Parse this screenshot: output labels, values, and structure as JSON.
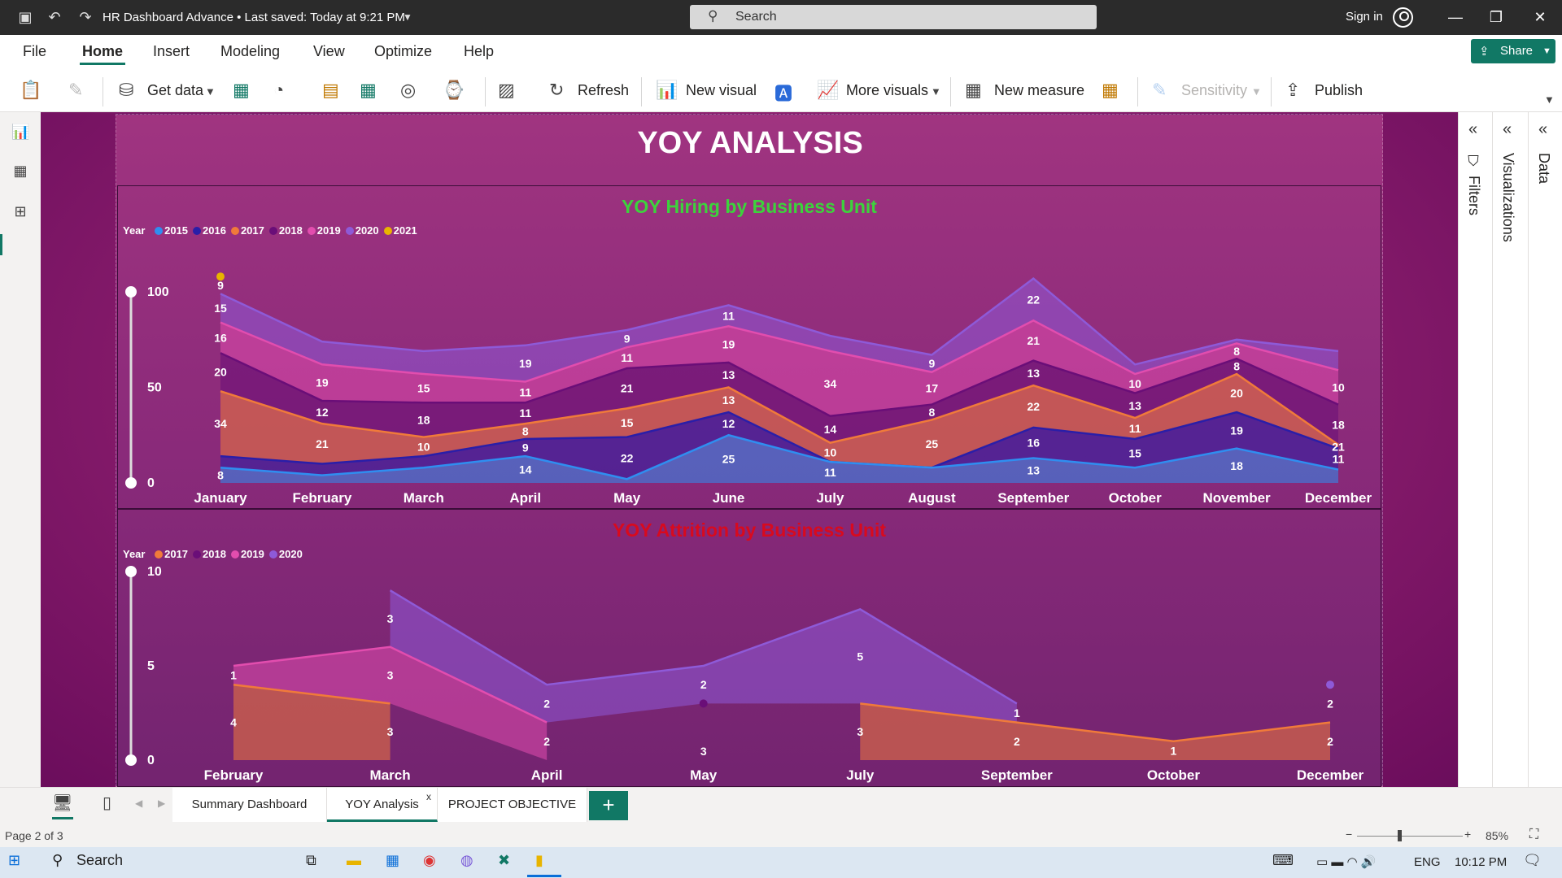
{
  "titlebar": {
    "title": "HR Dashboard Advance  •  Last saved: Today at 9:21 PM",
    "search_placeholder": "Search",
    "signin": "Sign in"
  },
  "menu": {
    "items": [
      "File",
      "Home",
      "Insert",
      "Modeling",
      "View",
      "Optimize",
      "Help"
    ],
    "active": "Home",
    "share": "Share"
  },
  "ribbon": {
    "get_data": "Get data",
    "refresh": "Refresh",
    "new_visual": "New visual",
    "more_visuals": "More visuals",
    "new_measure": "New measure",
    "sensitivity": "Sensitivity",
    "publish": "Publish"
  },
  "panes": {
    "filters": "Filters",
    "visualizations": "Visualizations",
    "data": "Data"
  },
  "report": {
    "title": "YOY ANALYSIS"
  },
  "colors": {
    "2015": "#2f8ef0",
    "2016": "#2a1ea8",
    "2017": "#f07a3a",
    "2018": "#6a0e78",
    "2019": "#e24dae",
    "2020": "#8e5ad8",
    "2021": "#e8b400",
    "hiring_title": "#3cd33c",
    "attrition_title": "#d80a1e"
  },
  "chart_data": [
    {
      "type": "area",
      "title": "YOY Hiring by Business Unit",
      "legend_title": "Year",
      "categories": [
        "January",
        "February",
        "March",
        "April",
        "May",
        "June",
        "July",
        "August",
        "September",
        "October",
        "November",
        "December"
      ],
      "ylim": [
        0,
        100
      ],
      "yticks": [
        0,
        50,
        100
      ],
      "stacked": true,
      "series": [
        {
          "name": "2015",
          "values": [
            8,
            4,
            8,
            14,
            2,
            25,
            11,
            8,
            13,
            8,
            18,
            7
          ]
        },
        {
          "name": "2016",
          "values": [
            6,
            6,
            6,
            9,
            22,
            12,
            0,
            0,
            16,
            15,
            19,
            11
          ]
        },
        {
          "name": "2017",
          "values": [
            34,
            21,
            10,
            8,
            15,
            13,
            10,
            25,
            22,
            11,
            20,
            2
          ]
        },
        {
          "name": "2018",
          "values": [
            20,
            12,
            18,
            11,
            21,
            13,
            14,
            8,
            13,
            13,
            8,
            21
          ]
        },
        {
          "name": "2019",
          "values": [
            16,
            19,
            15,
            11,
            11,
            19,
            34,
            17,
            21,
            10,
            8,
            18
          ]
        },
        {
          "name": "2020",
          "values": [
            15,
            12,
            12,
            19,
            9,
            11,
            8,
            9,
            22,
            5,
            2,
            10
          ]
        },
        {
          "name": "2021",
          "values": [
            9,
            null,
            null,
            null,
            null,
            null,
            null,
            null,
            null,
            null,
            null,
            null
          ]
        }
      ],
      "data_labels": [
        [
          "8",
          "",
          "",
          "14",
          "",
          "25",
          "11",
          "",
          "13",
          "",
          "18",
          ""
        ],
        [
          "",
          "",
          "",
          "9",
          "22",
          "12",
          "",
          "",
          "16",
          "15",
          "19",
          "11"
        ],
        [
          "34",
          "21",
          "10",
          "8",
          "15",
          "13",
          "10",
          "25",
          "22",
          "11",
          "20",
          "21"
        ],
        [
          "20",
          "12",
          "18",
          "11",
          "21",
          "13",
          "14",
          "8",
          "13",
          "13",
          "8",
          "18"
        ],
        [
          "16",
          "19",
          "15",
          "11",
          "11",
          "19",
          "34",
          "17",
          "21",
          "10",
          "8",
          "10"
        ],
        [
          "15",
          "",
          "",
          "19",
          "9",
          "11",
          "",
          "9",
          "22",
          "",
          "",
          ""
        ],
        [
          "9",
          "",
          "",
          "",
          "",
          "",
          "",
          "",
          "",
          "",
          "",
          ""
        ]
      ]
    },
    {
      "type": "area",
      "title": "YOY Attrition by Business Unit",
      "legend_title": "Year",
      "categories": [
        "February",
        "March",
        "April",
        "May",
        "July",
        "September",
        "October",
        "December"
      ],
      "ylim": [
        0,
        10
      ],
      "yticks": [
        0,
        5,
        10
      ],
      "stacked": true,
      "series": [
        {
          "name": "2017",
          "values": [
            4,
            3,
            null,
            null,
            3,
            2,
            1,
            2
          ]
        },
        {
          "name": "2018",
          "values": [
            null,
            null,
            null,
            3,
            null,
            null,
            null,
            null
          ]
        },
        {
          "name": "2019",
          "values": [
            1,
            3,
            2,
            null,
            null,
            null,
            null,
            null
          ]
        },
        {
          "name": "2020",
          "values": [
            null,
            3,
            2,
            2,
            5,
            1,
            null,
            2
          ]
        }
      ],
      "data_labels": [
        [
          "4",
          "3",
          "",
          "3",
          "3",
          "2",
          "1",
          "2"
        ],
        [
          "",
          "",
          "",
          "",
          "",
          "",
          "",
          ""
        ],
        [
          "1",
          "3",
          "2",
          "",
          "",
          "",
          "",
          ""
        ],
        [
          "",
          "3",
          "2",
          "2",
          "5",
          "1",
          "",
          "2"
        ]
      ]
    }
  ],
  "tabs": {
    "items": [
      "Summary Dashboard",
      "YOY Analysis",
      "PROJECT OBJECTIVE"
    ],
    "active": "YOY Analysis",
    "close": "x",
    "add": "+"
  },
  "status": {
    "page": "Page 2 of 3",
    "zoom": "85%"
  },
  "taskbar": {
    "search": "Search",
    "lang": "ENG",
    "time": "10:12 PM"
  }
}
